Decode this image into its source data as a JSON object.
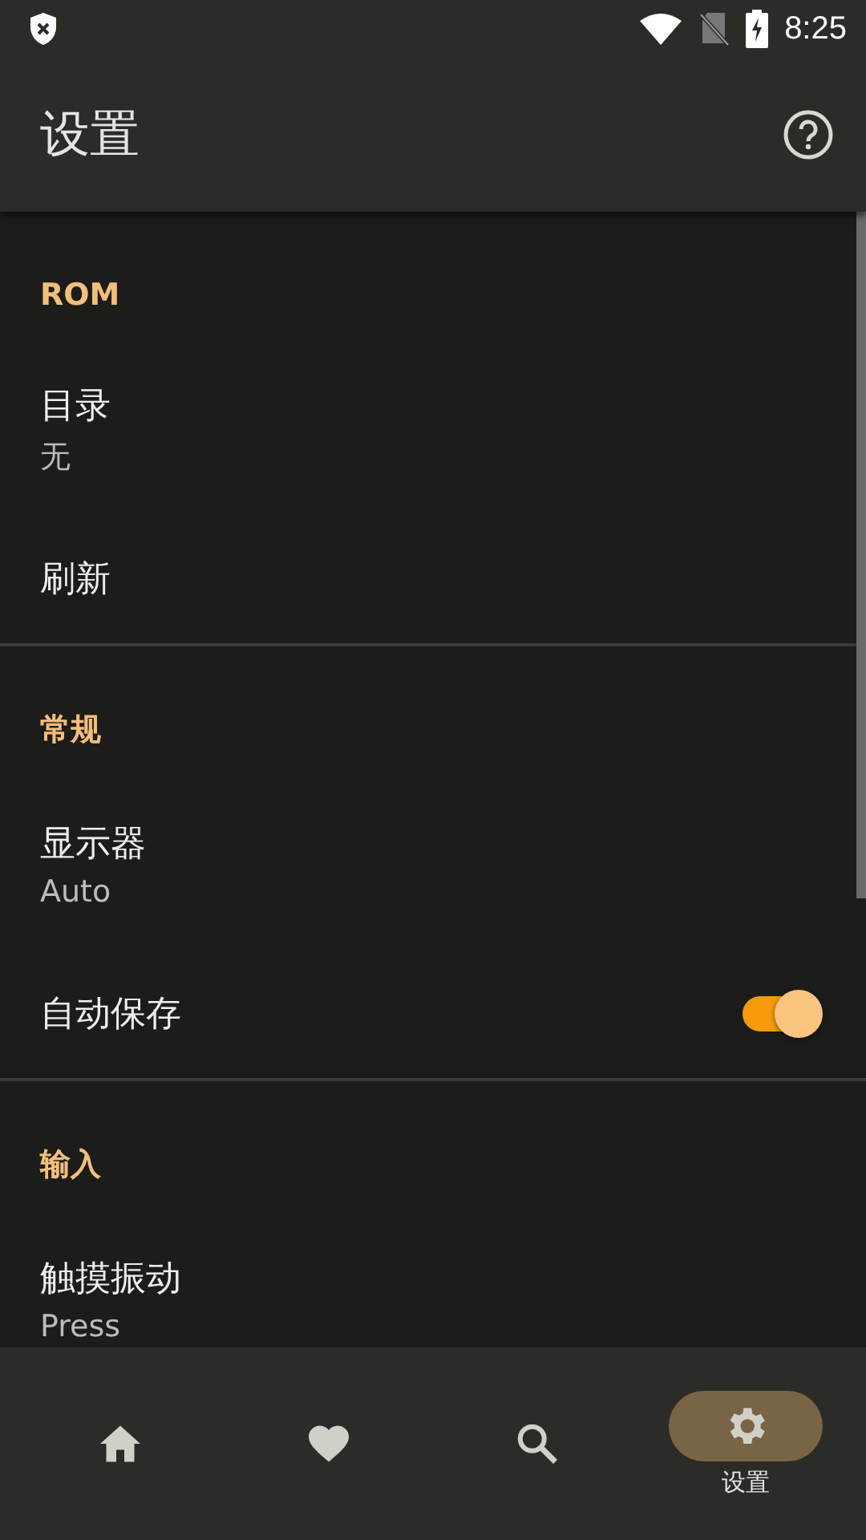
{
  "status_bar": {
    "time": "8:25"
  },
  "app_bar": {
    "title": "设置"
  },
  "sections": [
    {
      "title": "ROM",
      "items": [
        {
          "kind": "plain",
          "title": "目录",
          "summary": "无"
        },
        {
          "kind": "plain",
          "title": "刷新"
        }
      ]
    },
    {
      "title": "常规",
      "items": [
        {
          "kind": "plain",
          "title": "显示器",
          "summary": "Auto"
        },
        {
          "kind": "switch",
          "title": "自动保存",
          "on": true
        }
      ]
    },
    {
      "title": "输入",
      "items": [
        {
          "kind": "plain",
          "title": "触摸振动",
          "summary": "Press"
        }
      ]
    }
  ],
  "bottom_nav": [
    {
      "selected": false
    },
    {
      "selected": false
    },
    {
      "selected": false
    },
    {
      "selected": true,
      "label": "设置"
    }
  ]
}
